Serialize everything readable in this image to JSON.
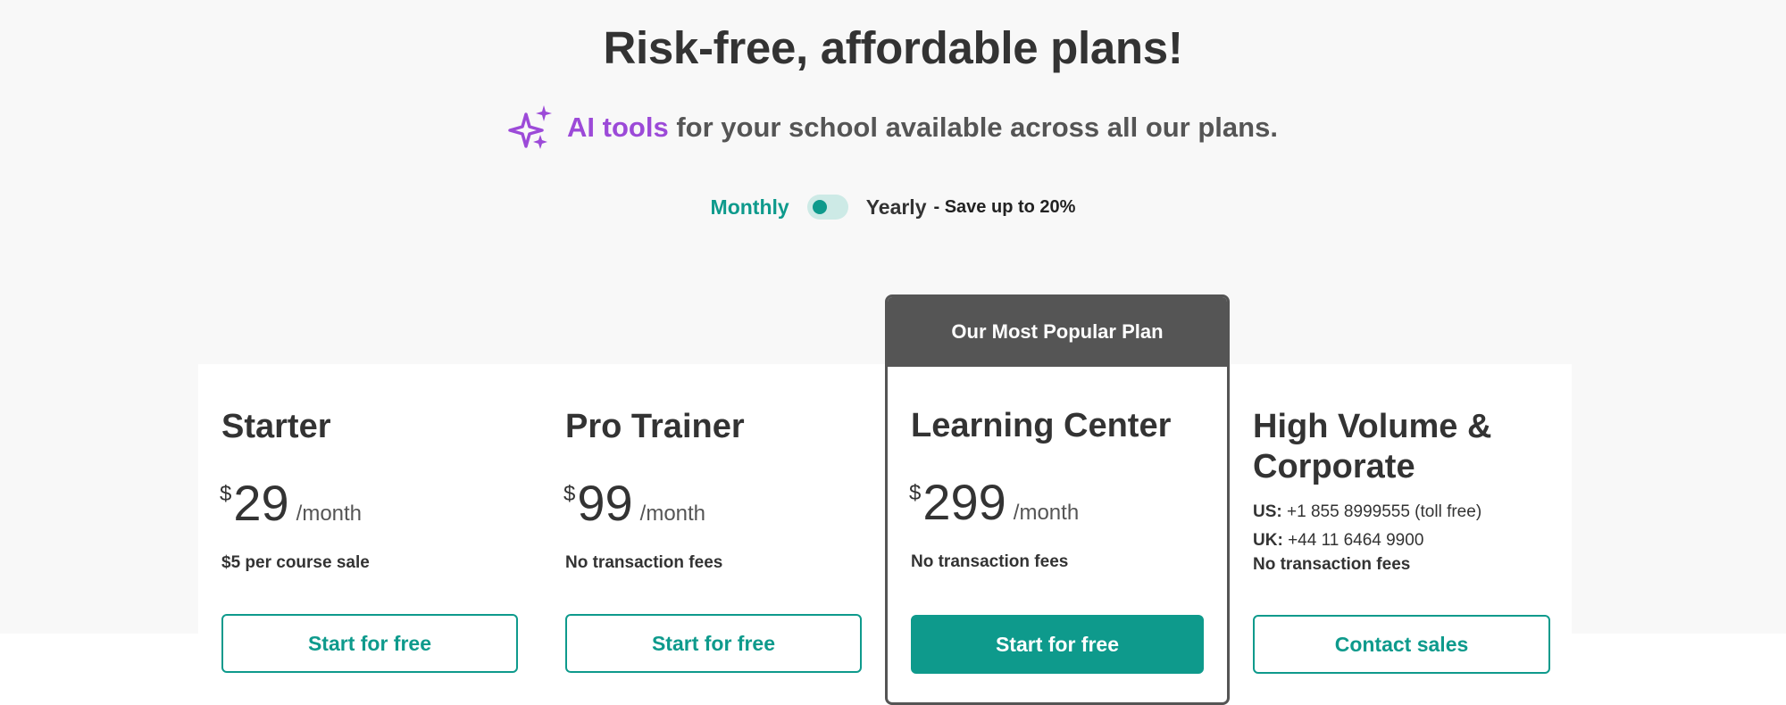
{
  "header": {
    "title": "Risk-free, affordable plans!",
    "ai_highlight": "AI tools",
    "ai_rest": "for your school available across all our plans.",
    "ai_icon": "sparkles-icon"
  },
  "billing": {
    "monthly_label": "Monthly",
    "yearly_label": "Yearly",
    "save_label": "- Save up to 20%",
    "selected": "Monthly"
  },
  "colors": {
    "accent": "#0e9a8c",
    "ai_purple": "#9c4ad8",
    "popular_banner": "#555555"
  },
  "plans": [
    {
      "name": "Starter",
      "currency": "$",
      "price": "29",
      "period": "/month",
      "note": "$5 per course sale",
      "cta": "Start for free"
    },
    {
      "name": "Pro Trainer",
      "currency": "$",
      "price": "99",
      "period": "/month",
      "note": "No transaction fees",
      "cta": "Start for free"
    },
    {
      "name": "Learning Center",
      "badge": "Our Most Popular Plan",
      "currency": "$",
      "price": "299",
      "period": "/month",
      "note": "No transaction fees",
      "cta": "Start for free"
    },
    {
      "name": "High Volume & Corporate",
      "us_label": "US:",
      "us_phone": "+1 855 8999555 (toll free)",
      "uk_label": "UK:",
      "uk_phone": "+44 11 6464 9900",
      "note": "No transaction fees",
      "cta": "Contact sales"
    }
  ]
}
